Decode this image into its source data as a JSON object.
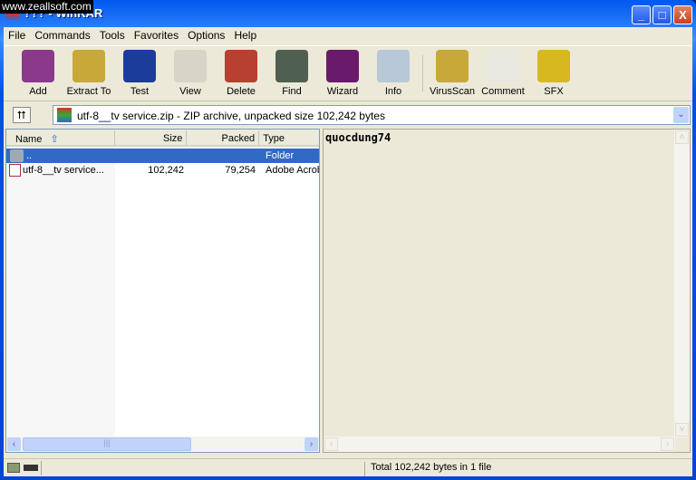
{
  "watermark": "www.zeallsoft.com",
  "window": {
    "title": "??? - WinRAR",
    "minimize": "_",
    "maximize": "□",
    "close": "X"
  },
  "menu": [
    "File",
    "Commands",
    "Tools",
    "Favorites",
    "Options",
    "Help"
  ],
  "toolbar": [
    {
      "label": "Add",
      "icon": "add-archive-icon",
      "color": "#8b3a8b"
    },
    {
      "label": "Extract To",
      "icon": "extract-icon",
      "color": "#c8a838"
    },
    {
      "label": "Test",
      "icon": "test-icon",
      "color": "#1c3c9c"
    },
    {
      "label": "View",
      "icon": "view-icon",
      "color": "#d8d4c8"
    },
    {
      "label": "Delete",
      "icon": "delete-icon",
      "color": "#b84030"
    },
    {
      "label": "Find",
      "icon": "find-icon",
      "color": "#506050"
    },
    {
      "label": "Wizard",
      "icon": "wizard-icon",
      "color": "#6a1a6a"
    }
  ],
  "toolbar2": [
    {
      "label": "Info",
      "icon": "info-icon",
      "color": "#b8c8d8"
    },
    {
      "label": "VirusScan",
      "icon": "virusscan-icon",
      "color": "#c8a838"
    },
    {
      "label": "Comment",
      "icon": "comment-icon",
      "color": "#e8e8e0"
    },
    {
      "label": "SFX",
      "icon": "sfx-icon",
      "color": "#d8b820"
    }
  ],
  "address": {
    "value": "utf-8__tv service.zip - ZIP archive, unpacked size 102,242 bytes",
    "up": "⮅",
    "dropdown": "⌄"
  },
  "columns": {
    "name": "Name",
    "sort": "⇧",
    "size": "Size",
    "packed": "Packed",
    "type": "Type"
  },
  "files": [
    {
      "name": "..",
      "size": "",
      "packed": "",
      "type": "Folder",
      "icon": "folder-icon"
    },
    {
      "name": "utf-8__tv service...",
      "size": "102,242",
      "packed": "79,254",
      "type": "Adobe Acrobat",
      "icon": "pdf-icon"
    }
  ],
  "comment": "quocdung74",
  "status": {
    "total": "Total 102,242 bytes in 1 file"
  }
}
